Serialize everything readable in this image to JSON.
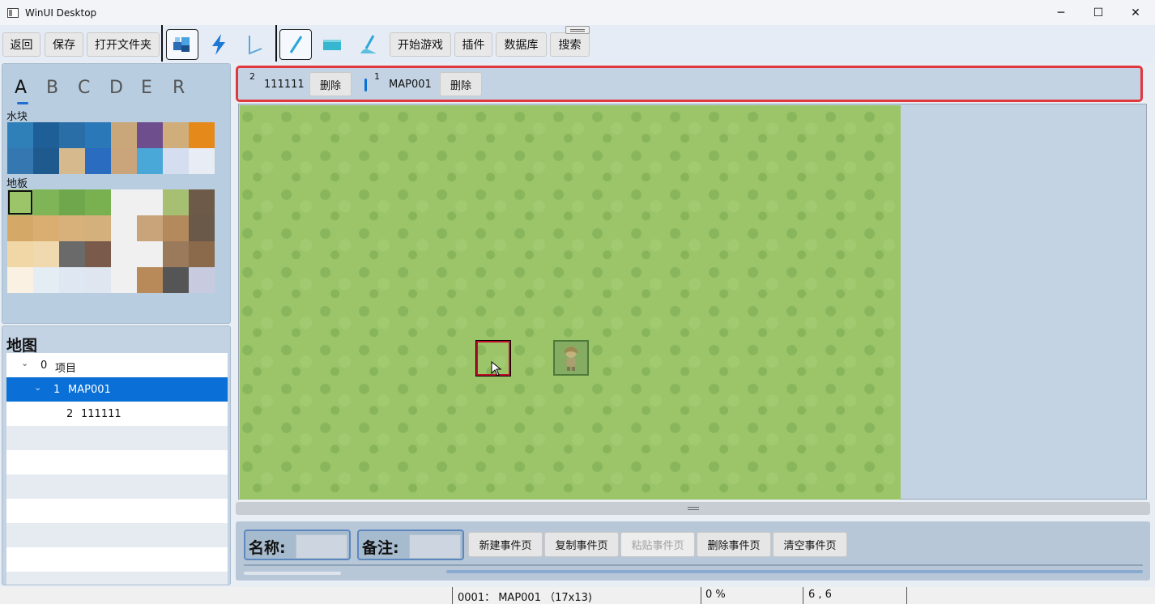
{
  "window": {
    "title": "WinUI Desktop",
    "minimize": "─",
    "maximize": "☐",
    "close": "✕"
  },
  "toolbar": {
    "back": "返回",
    "save": "保存",
    "open_folder": "打开文件夹",
    "start_game": "开始游戏",
    "plugins": "插件",
    "database": "数据库",
    "search": "搜索"
  },
  "tileset": {
    "tabs": [
      "A",
      "B",
      "C",
      "D",
      "E",
      "R"
    ],
    "active_tab": "A",
    "water_label": "水块",
    "floor_label": "地板"
  },
  "maptree": {
    "title": "地图",
    "items": [
      {
        "id": "0",
        "name": "项目",
        "expanded": true
      },
      {
        "id": "1",
        "name": "MAP001",
        "expanded": true,
        "selected": true
      },
      {
        "id": "2",
        "name": "111111"
      }
    ]
  },
  "map_tabs": [
    {
      "index": "2",
      "name": "111111",
      "delete": "删除"
    },
    {
      "index": "1",
      "name": "MAP001",
      "delete": "删除",
      "active": true
    }
  ],
  "event": {
    "name_label": "名称:",
    "note_label": "备注:",
    "new_page": "新建事件页",
    "copy_page": "复制事件页",
    "paste_page": "粘贴事件页",
    "delete_page": "删除事件页",
    "clear_page": "清空事件页"
  },
  "status": {
    "map_info": "0001： MAP001 （17x13)",
    "zoom": "0 %",
    "coords": "6 , 6"
  },
  "colors": {
    "accent": "#0a6fd6",
    "highlight_red": "#e0383c",
    "grass": "#9cc56a"
  }
}
